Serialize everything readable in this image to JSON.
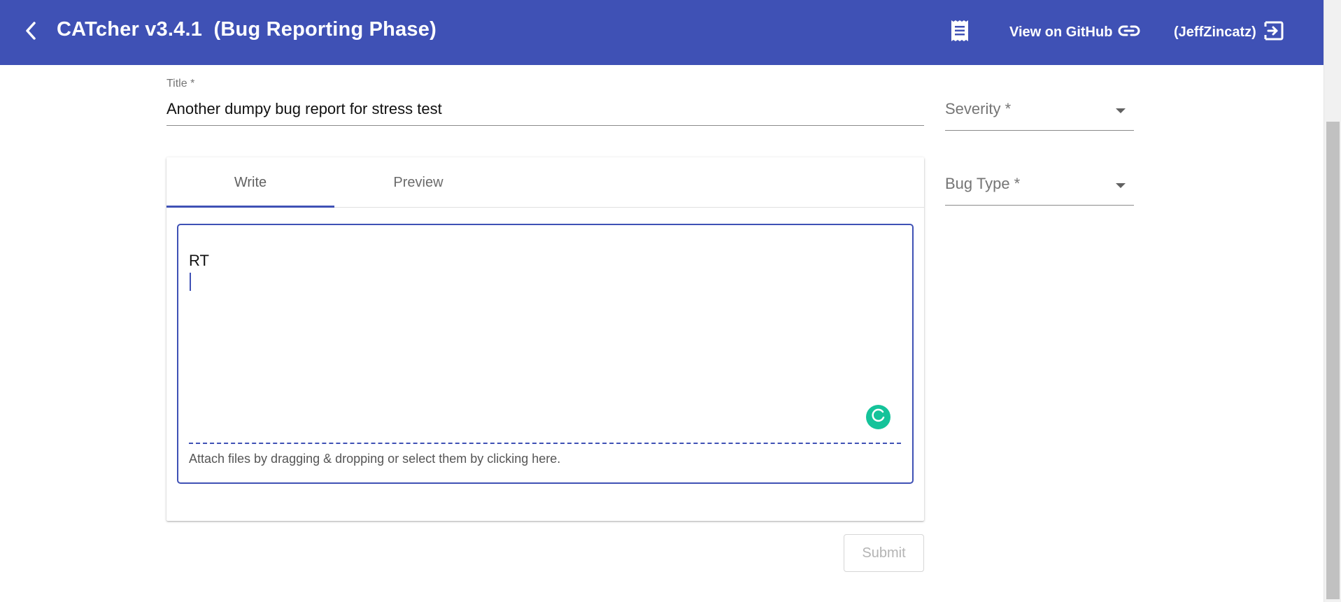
{
  "header": {
    "app_title": "CATcher v3.4.1  (Bug Reporting Phase)",
    "github_label": "View on GitHub",
    "user_label": "(JeffZincatz)",
    "background_color": "#3f51b5"
  },
  "icons": {
    "back": "chevron-left-icon",
    "document": "receipt-icon",
    "link": "link-icon",
    "logout": "logout-icon",
    "grammar": "grammarly-icon"
  },
  "form": {
    "title_label": "Title *",
    "title_value": "Another dumpy bug report for stress test",
    "severity_label": "Severity *",
    "bug_type_label": "Bug Type *"
  },
  "editor": {
    "tabs": [
      {
        "label": "Write",
        "active": true
      },
      {
        "label": "Preview",
        "active": false
      }
    ],
    "content": "RT",
    "attach_hint": "Attach files by dragging & dropping or select them by clicking here."
  },
  "actions": {
    "submit_label": "Submit",
    "submit_enabled": false
  },
  "colors": {
    "primary": "#3f51b5",
    "grammarly": "#15c39a"
  }
}
